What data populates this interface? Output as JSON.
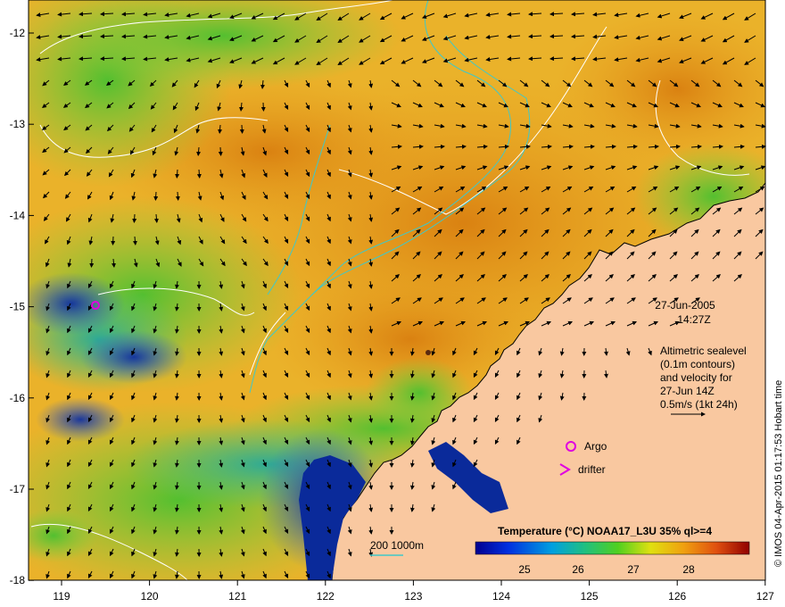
{
  "map": {
    "lon_ticks": [
      "119",
      "120",
      "121",
      "122",
      "123",
      "124",
      "125",
      "126",
      "127"
    ],
    "lat_ticks": [
      "-12",
      "-13",
      "-14",
      "-15",
      "-16",
      "-17",
      "-18"
    ],
    "date": "27-Jun-2005",
    "time": "14:27Z",
    "altimetry_lines": [
      "Altimetric sealevel",
      "(0.1m contours)",
      "and velocity for",
      "27-Jun 14Z",
      "0.5m/s (1kt 24h)"
    ],
    "legend_argo": "Argo",
    "legend_drifter": "drifter",
    "bathymetry_label": "200  1000m",
    "colorbar_title": "Temperature (°C) NOAA17_L3U 35% ql>=4",
    "colorbar_ticks": [
      "25",
      "26",
      "27",
      "28"
    ],
    "credit": "© IMOS 04-Apr-2015 01:17:53 Hobart time",
    "colors": {
      "land": "#f9c8a0",
      "sst_warm": "#e0900a",
      "sst_mid": "#f0c020",
      "sst_cool": "#5fc830",
      "sst_cold": "#1a3fc0",
      "contour": "#ffffff",
      "bathymetry": "#40c8c8",
      "argo": "#e000e0"
    }
  }
}
